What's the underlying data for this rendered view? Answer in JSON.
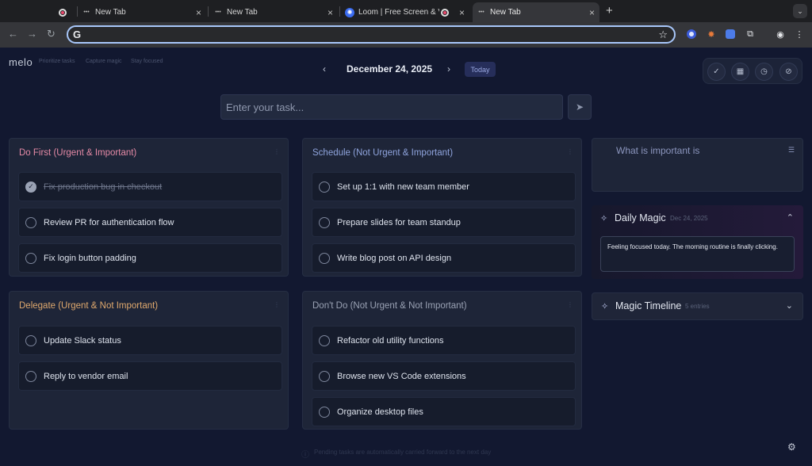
{
  "browser": {
    "tabs": [
      {
        "title": "",
        "favicon": "record-icon",
        "active": false
      },
      {
        "title": "New Tab",
        "favicon": "dots-icon",
        "active": false
      },
      {
        "title": "New Tab",
        "favicon": "dots-icon",
        "active": false
      },
      {
        "title": "Loom | Free Screen & Vid",
        "favicon": "loom-icon",
        "active": false
      },
      {
        "title": "New Tab",
        "favicon": "dots-icon",
        "active": true
      }
    ],
    "new_tab_label": "+",
    "close_label": "×",
    "address": {
      "value": "",
      "placeholder": ""
    },
    "extensions": [
      "1password-icon",
      "extension-spark-icon",
      "chrome-icon",
      "puzzle-icon",
      "profile-icon",
      "menu-icon"
    ]
  },
  "app": {
    "logo": "melo",
    "taglines": [
      "Prioritize tasks",
      "Capture magic",
      "Stay focused"
    ],
    "date": "December 24, 2025",
    "today_label": "Today",
    "toolbar_icons": [
      "check-circle-icon",
      "calendar-icon",
      "clock-icon",
      "hide-icon"
    ],
    "task_input": {
      "placeholder": "Enter your task...",
      "value": ""
    },
    "quadrants": [
      {
        "title": "Do First (Urgent & Important)",
        "color": "#e58aa6",
        "tasks": [
          {
            "text": "Fix production bug in checkout",
            "done": true
          },
          {
            "text": "Review PR for authentication flow",
            "done": false
          },
          {
            "text": "Fix login button padding",
            "done": false
          }
        ]
      },
      {
        "title": "Schedule (Not Urgent & Important)",
        "color": "#8fa4dd",
        "tasks": [
          {
            "text": "Set up 1:1 with new team member",
            "done": false
          },
          {
            "text": "Prepare slides for team standup",
            "done": false
          },
          {
            "text": "Write blog post on API design",
            "done": false
          }
        ]
      },
      {
        "title": "Delegate (Urgent & Not Important)",
        "color": "#e0a96d",
        "tasks": [
          {
            "text": "Update Slack status",
            "done": false
          },
          {
            "text": "Reply to vendor email",
            "done": false
          }
        ]
      },
      {
        "title": "Don't Do (Not Urgent & Not Important)",
        "color": "#9aa2b4",
        "tasks": [
          {
            "text": "Refactor old utility functions",
            "done": false
          },
          {
            "text": "Browse new VS Code extensions",
            "done": false
          },
          {
            "text": "Organize desktop files",
            "done": false
          }
        ]
      }
    ],
    "important_prompt": "What is important is",
    "daily_magic": {
      "title": "Daily Magic",
      "date": "Dec 24, 2025",
      "note": "Feeling focused today. The morning routine is finally clicking."
    },
    "magic_timeline": {
      "title": "Magic Timeline",
      "count": "5 entries"
    },
    "footer_note": "Pending tasks are automatically carried forward to the next day"
  }
}
